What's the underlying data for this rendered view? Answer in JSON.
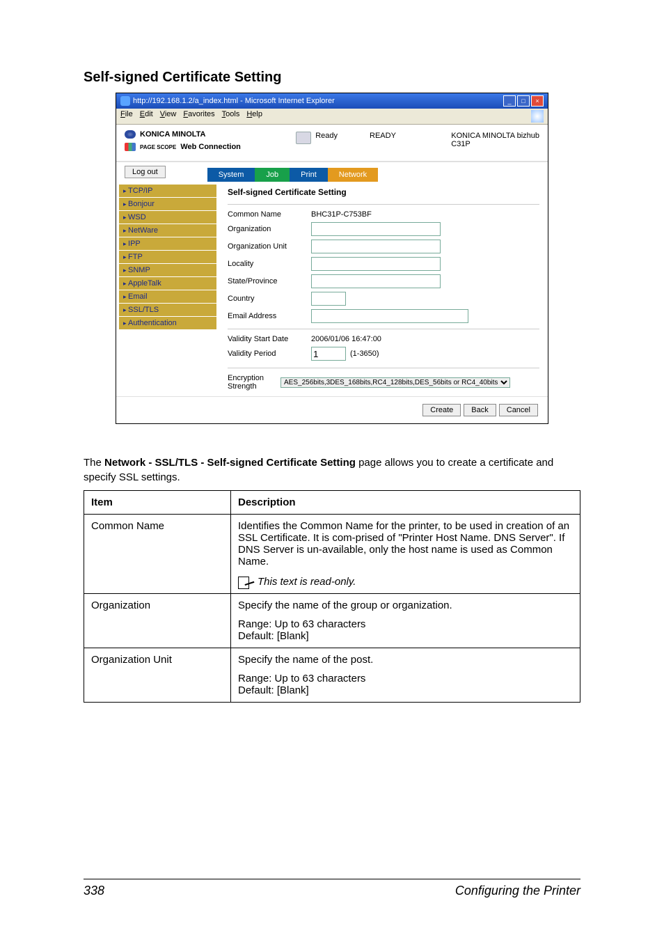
{
  "heading": "Self-signed Certificate Setting",
  "ie": {
    "title": "http://192.168.1.2/a_index.html - Microsoft Internet Explorer",
    "menu": [
      "File",
      "Edit",
      "View",
      "Favorites",
      "Tools",
      "Help"
    ]
  },
  "header": {
    "brand": "KONICA MINOLTA",
    "pagescope_prefix": "PAGE SCOPE",
    "pagescope": "Web Connection",
    "status_label": "Ready",
    "status_big": "READY",
    "model_line1": "KONICA MINOLTA bizhub",
    "model_line2": "C31P",
    "logout": "Log out"
  },
  "tabs": {
    "system": "System",
    "job": "Job",
    "print": "Print",
    "network": "Network"
  },
  "sidebar": [
    "TCP/IP",
    "Bonjour",
    "WSD",
    "NetWare",
    "IPP",
    "FTP",
    "SNMP",
    "AppleTalk",
    "Email",
    "SSL/TLS",
    "Authentication"
  ],
  "pane": {
    "title": "Self-signed Certificate Setting",
    "common_name_label": "Common Name",
    "common_name_value": "BHC31P-C753BF",
    "organization_label": "Organization",
    "org_unit_label": "Organization Unit",
    "locality_label": "Locality",
    "state_label": "State/Province",
    "country_label": "Country",
    "email_label": "Email Address",
    "vstart_label": "Validity Start Date",
    "vstart_value": "2006/01/06 16:47:00",
    "vperiod_label": "Validity Period",
    "vperiod_value": "1",
    "vperiod_range": "(1-3650)",
    "enc_label": "Encryption Strength",
    "enc_value": "AES_256bits,3DES_168bits,RC4_128bits,DES_56bits or RC4_40bits"
  },
  "buttons": {
    "create": "Create",
    "back": "Back",
    "cancel": "Cancel"
  },
  "caption_a": "The ",
  "caption_b": "Network - SSL/TLS - Self-signed Certificate Setting",
  "caption_c": " page allows you to create a certificate and specify SSL settings.",
  "table": {
    "h_item": "Item",
    "h_desc": "Description",
    "rows": [
      {
        "item": "Common Name",
        "desc": "Identifies the Common Name for the printer, to be used in creation of an SSL Certificate. It is com-prised of \"Printer Host Name. DNS Server\". If DNS Server is un-available, only the host name is used as Common Name.",
        "note": "This text is read-only."
      },
      {
        "item": "Organization",
        "desc": "Specify the name of the group or organization.",
        "range": "Range:   Up to 63 characters",
        "def": "Default:  [Blank]"
      },
      {
        "item": "Organization Unit",
        "desc": "Specify the name of the post.",
        "range": "Range:   Up to 63 characters",
        "def": "Default:  [Blank]"
      }
    ]
  },
  "footer": {
    "page": "338",
    "section": "Configuring the Printer"
  }
}
